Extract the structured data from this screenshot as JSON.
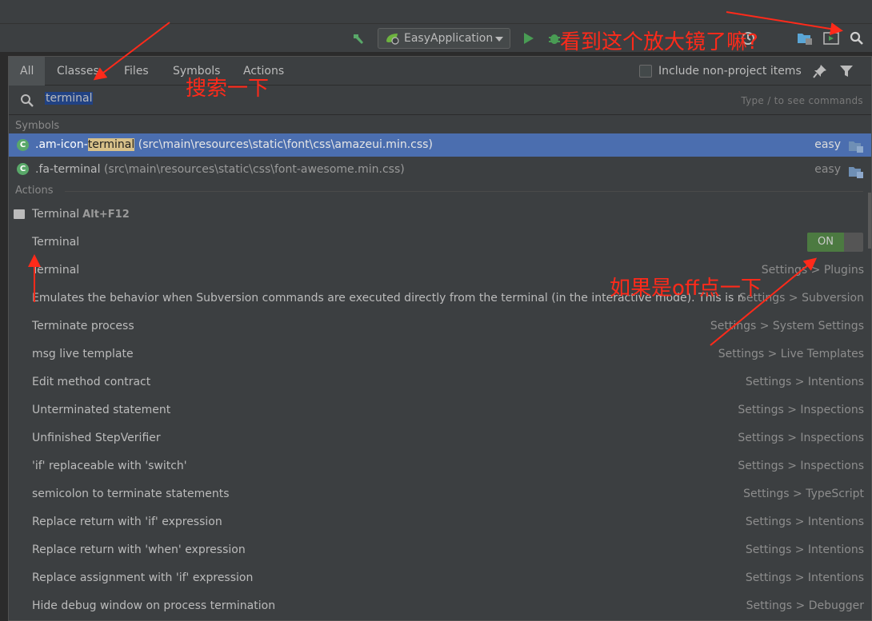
{
  "toolbar": {
    "run_config_label": "EasyApplication",
    "icons": [
      "hammer-icon",
      "run-icon",
      "debug-icon",
      "profiler-icon",
      "project-structure-icon",
      "run-dashboard-icon",
      "search-everywhere-icon"
    ]
  },
  "popup": {
    "tabs": [
      "All",
      "Classes",
      "Files",
      "Symbols",
      "Actions"
    ],
    "active_tab": "All",
    "include_label": "Include non-project items",
    "search_value": "terminal",
    "hint": "Type / to see commands",
    "sections": {
      "symbols": "Symbols",
      "actions": "Actions"
    },
    "symbol_rows": [
      {
        "prefix": ".am-icon-",
        "match": "terminal",
        "path": " (src\\main\\resources\\static\\font\\css\\amazeui.min.css)",
        "module": "easy",
        "selected": true
      },
      {
        "prefix": ".fa-terminal",
        "match": "",
        "path": " (src\\main\\resources\\static\\css\\font-awesome.min.css)",
        "module": "easy",
        "selected": false
      }
    ],
    "action_rows": [
      {
        "name": "Terminal",
        "shortcut": "Alt+F12",
        "location": ""
      },
      {
        "name": "Terminal",
        "shortcut": "",
        "location": "",
        "toggle": "ON"
      },
      {
        "name": "Terminal",
        "shortcut": "",
        "location": "Settings > Plugins"
      },
      {
        "name": "Emulates the behavior when Subversion commands are executed directly from the terminal (in the interactive mode). This is required to...",
        "shortcut": "",
        "location": "Settings > Subversion"
      },
      {
        "name": "Terminate process",
        "shortcut": "",
        "location": "Settings > System Settings"
      },
      {
        "name": "msg live template",
        "shortcut": "",
        "location": "Settings > Live Templates"
      },
      {
        "name": "Edit method contract",
        "shortcut": "",
        "location": "Settings > Intentions"
      },
      {
        "name": "Unterminated statement",
        "shortcut": "",
        "location": "Settings > Inspections"
      },
      {
        "name": "Unfinished StepVerifier",
        "shortcut": "",
        "location": "Settings > Inspections"
      },
      {
        "name": "'if' replaceable with 'switch'",
        "shortcut": "",
        "location": "Settings > Inspections"
      },
      {
        "name": "semicolon to terminate statements",
        "shortcut": "",
        "location": "Settings > TypeScript"
      },
      {
        "name": "Replace return with 'if' expression",
        "shortcut": "",
        "location": "Settings > Intentions"
      },
      {
        "name": "Replace return with 'when' expression",
        "shortcut": "",
        "location": "Settings > Intentions"
      },
      {
        "name": "Replace assignment with 'if' expression",
        "shortcut": "",
        "location": "Settings > Intentions"
      },
      {
        "name": "Hide debug window on process termination",
        "shortcut": "",
        "location": "Settings > Debugger"
      }
    ]
  },
  "annotations": {
    "magnifier": "看到这个放大镜了嘛?",
    "search": "搜索一下",
    "off": "如果是off点一下"
  },
  "colors": {
    "selection": "#4b6eaf",
    "annotation": "#ff2a1a",
    "toggle_on": "#4c7a41"
  }
}
